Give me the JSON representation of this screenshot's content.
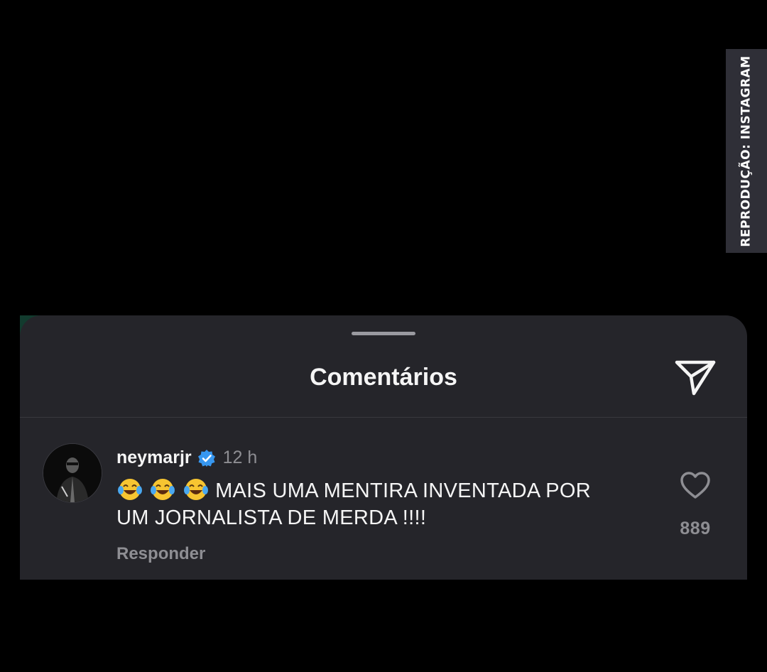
{
  "watermark": {
    "text": "REPRODUÇÃO: INSTAGRAM"
  },
  "comments_sheet": {
    "title": "Comentários",
    "share_icon": "send-paper-plane-icon",
    "comment": {
      "username": "neymarjr",
      "verified_icon": "verified-badge-icon",
      "timestamp": "12 h",
      "emojis": [
        "😂",
        "😂",
        "😂"
      ],
      "text_line1": "MAIS UMA MENTIRA INVENTADA POR",
      "text_line2": "UM JORNALISTA DE MERDA !!!!",
      "reply_label": "Responder",
      "like_icon": "heart-outline-icon",
      "like_count": "889"
    }
  },
  "colors": {
    "background": "#000000",
    "sheet": "#25252a",
    "text_primary": "#f5f5f5",
    "text_secondary": "#8e8e93",
    "verified": "#3797f0",
    "watermark_tab": "#2f2f37"
  }
}
